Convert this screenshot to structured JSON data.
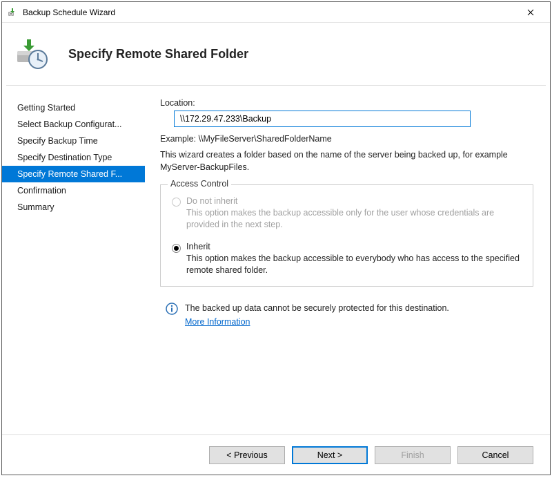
{
  "window": {
    "title": "Backup Schedule Wizard"
  },
  "header": {
    "title": "Specify Remote Shared Folder"
  },
  "sidebar": {
    "items": [
      {
        "label": "Getting Started"
      },
      {
        "label": "Select Backup Configurat..."
      },
      {
        "label": "Specify Backup Time"
      },
      {
        "label": "Specify Destination Type"
      },
      {
        "label": "Specify Remote Shared F..."
      },
      {
        "label": "Confirmation"
      },
      {
        "label": "Summary"
      }
    ],
    "selectedIndex": 4
  },
  "content": {
    "locationLabel": "Location:",
    "locationValue": "\\\\172.29.47.233\\Backup",
    "example": "Example: \\\\MyFileServer\\SharedFolderName",
    "wizardDesc": "This wizard creates a folder based on the name of the server being backed up, for example MyServer-BackupFiles.",
    "accessControl": {
      "legend": "Access Control",
      "doNotInherit": {
        "label": "Do not inherit",
        "desc": "This option makes the backup accessible only for the user whose credentials are provided in the next step.",
        "enabled": false,
        "selected": false
      },
      "inherit": {
        "label": "Inherit",
        "desc": "This option makes the backup accessible to everybody who has access to the specified remote shared folder.",
        "enabled": true,
        "selected": true
      }
    },
    "info": {
      "text": "The backed up data cannot be securely protected for this destination.",
      "link": "More Information"
    }
  },
  "footer": {
    "previous": "< Previous",
    "next": "Next >",
    "finish": "Finish",
    "cancel": "Cancel"
  }
}
